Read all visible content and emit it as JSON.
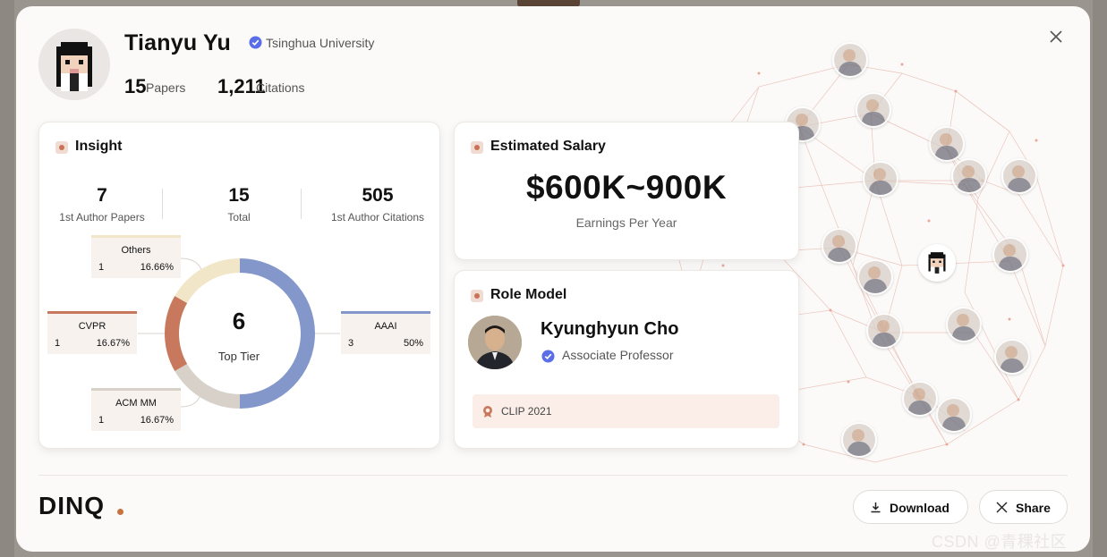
{
  "profile": {
    "name": "Tianyu Yu",
    "affiliation": "Tsinghua University",
    "papers_count": "15",
    "papers_label": "Papers",
    "citations_count": "1,211",
    "citations_label": "Citations"
  },
  "insight": {
    "title": "Insight",
    "stats": [
      {
        "value": "7",
        "label": "1st Author Papers"
      },
      {
        "value": "15",
        "label": "Total"
      },
      {
        "value": "505",
        "label": "1st Author Citations"
      }
    ],
    "center_value": "6",
    "center_label": "Top Tier",
    "chart_data": {
      "type": "pie",
      "categories": [
        "AAAI",
        "ACM MM",
        "CVPR",
        "Others"
      ],
      "counts": [
        3,
        1,
        1,
        1
      ],
      "values": [
        50,
        16.67,
        16.67,
        16.66
      ],
      "percent_labels": [
        "50%",
        "16.67%",
        "16.67%",
        "16.66%"
      ],
      "colors": [
        "#8497cb",
        "#d7d1ca",
        "#c8785c",
        "#f1e6c8"
      ]
    }
  },
  "salary": {
    "title": "Estimated Salary",
    "range": "$600K~900K",
    "subtitle": "Earnings Per Year"
  },
  "role_model": {
    "title": "Role Model",
    "name": "Kyunghyun Cho",
    "position": "Associate Professor",
    "achievement": "CLIP 2021"
  },
  "footer": {
    "logo": "DINQ",
    "download_label": "Download",
    "share_label": "Share"
  },
  "watermark": "CSDN @青稞社区"
}
